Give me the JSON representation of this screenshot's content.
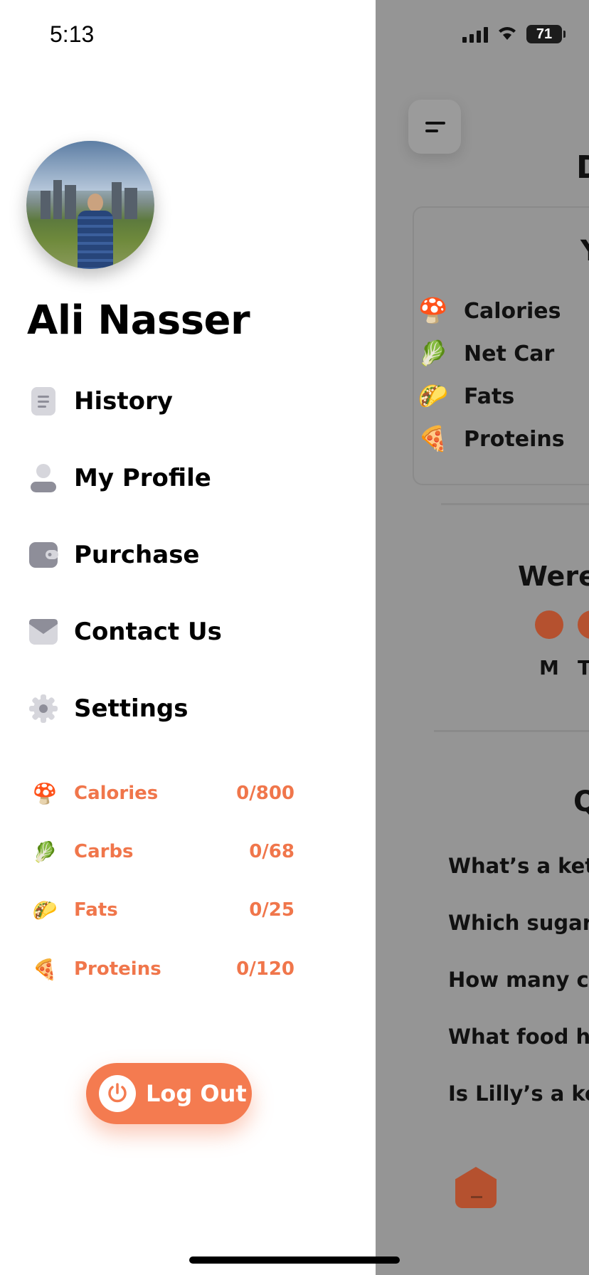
{
  "status_bar": {
    "time": "5:13",
    "battery": "71"
  },
  "profile": {
    "name": "Ali Nasser"
  },
  "nav": [
    {
      "label": "History",
      "icon": "history-doc-icon"
    },
    {
      "label": "My Profile",
      "icon": "person-icon"
    },
    {
      "label": "Purchase",
      "icon": "wallet-icon"
    },
    {
      "label": "Contact Us",
      "icon": "envelope-icon"
    },
    {
      "label": "Settings",
      "icon": "gear-icon"
    }
  ],
  "stats": [
    {
      "label": "Calories",
      "value": "0/800",
      "icon": "mushroom-icon"
    },
    {
      "label": "Carbs",
      "value": "0/68",
      "icon": "vegetables-icon"
    },
    {
      "label": "Fats",
      "value": "0/25",
      "icon": "taco-icon"
    },
    {
      "label": "Proteins",
      "value": "0/120",
      "icon": "pizza-icon"
    }
  ],
  "logout_label": "Log Out",
  "background": {
    "nutrients": [
      "Calories",
      "Net Car",
      "Fats",
      "Proteins"
    ],
    "section_title": "Were",
    "days": [
      "M",
      "T"
    ],
    "questions": [
      "What’s a keto",
      "Which sugar",
      "How many ca",
      "What food ha",
      "Is Lilly’s a ket"
    ]
  },
  "colors": {
    "accent": "#f47b50",
    "overlay": "#959595"
  }
}
